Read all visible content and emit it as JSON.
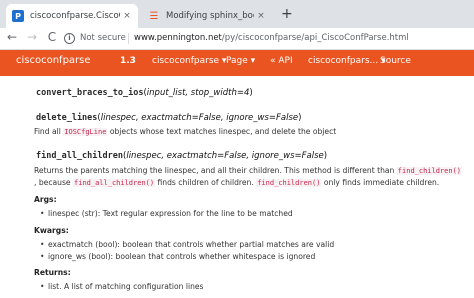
{
  "browser": {
    "active_tab": {
      "title": "ciscoconfparse.CiscoConfParse O",
      "favicon": "P",
      "close": "×"
    },
    "inactive_tab": {
      "title": "Modifying sphinx_bootstrap_the",
      "close": "×"
    },
    "new_tab": "+",
    "back": "←",
    "forward": "→",
    "reload": "C",
    "security_label": "Not secure",
    "url_host": "www.pennington.net",
    "url_path": "/py/ciscoconfparse/api_CiscoConfParse.html"
  },
  "navbar": {
    "brand": "ciscoconfparse",
    "version": "1.3",
    "menu1": "ciscoconfparse ▾",
    "menu2": "Page ▾",
    "api": "« API",
    "menu3": "ciscoconfpars... ▾",
    "source": "Source"
  },
  "docs": {
    "m1": {
      "name": "convert_braces_to_ios",
      "params": "input_list, stop_width=4"
    },
    "m2": {
      "name": "delete_lines",
      "params": "linespec, exactmatch=False, ignore_ws=False",
      "desc_a": "Find all ",
      "desc_code": "IOSCfgLine",
      "desc_b": " objects whose text matches linespec, and delete the object"
    },
    "m3": {
      "name": "find_all_children",
      "params": "linespec, exactmatch=False, ignore_ws=False",
      "line1_a": "Returns the parents matching the linespec, and all their children. This method is different than ",
      "line1_code": "find_children()",
      "line2_a": ", because ",
      "line2_code1": "find_all_children()",
      "line2_b": " finds children of children. ",
      "line2_code2": "find_children()",
      "line2_c": " only finds immediate children.",
      "args_label": "Args:",
      "arg1": "linespec (str): Text regular expression for the line to be matched",
      "kwargs_label": "Kwargs:",
      "kw1": "exactmatch (bool): boolean that controls whether partial matches are valid",
      "kw2": "ignore_ws (bool): boolean that controls whether whitespace is ignored",
      "returns_label": "Returns:",
      "ret1": "list. A list of matching configuration lines"
    }
  }
}
